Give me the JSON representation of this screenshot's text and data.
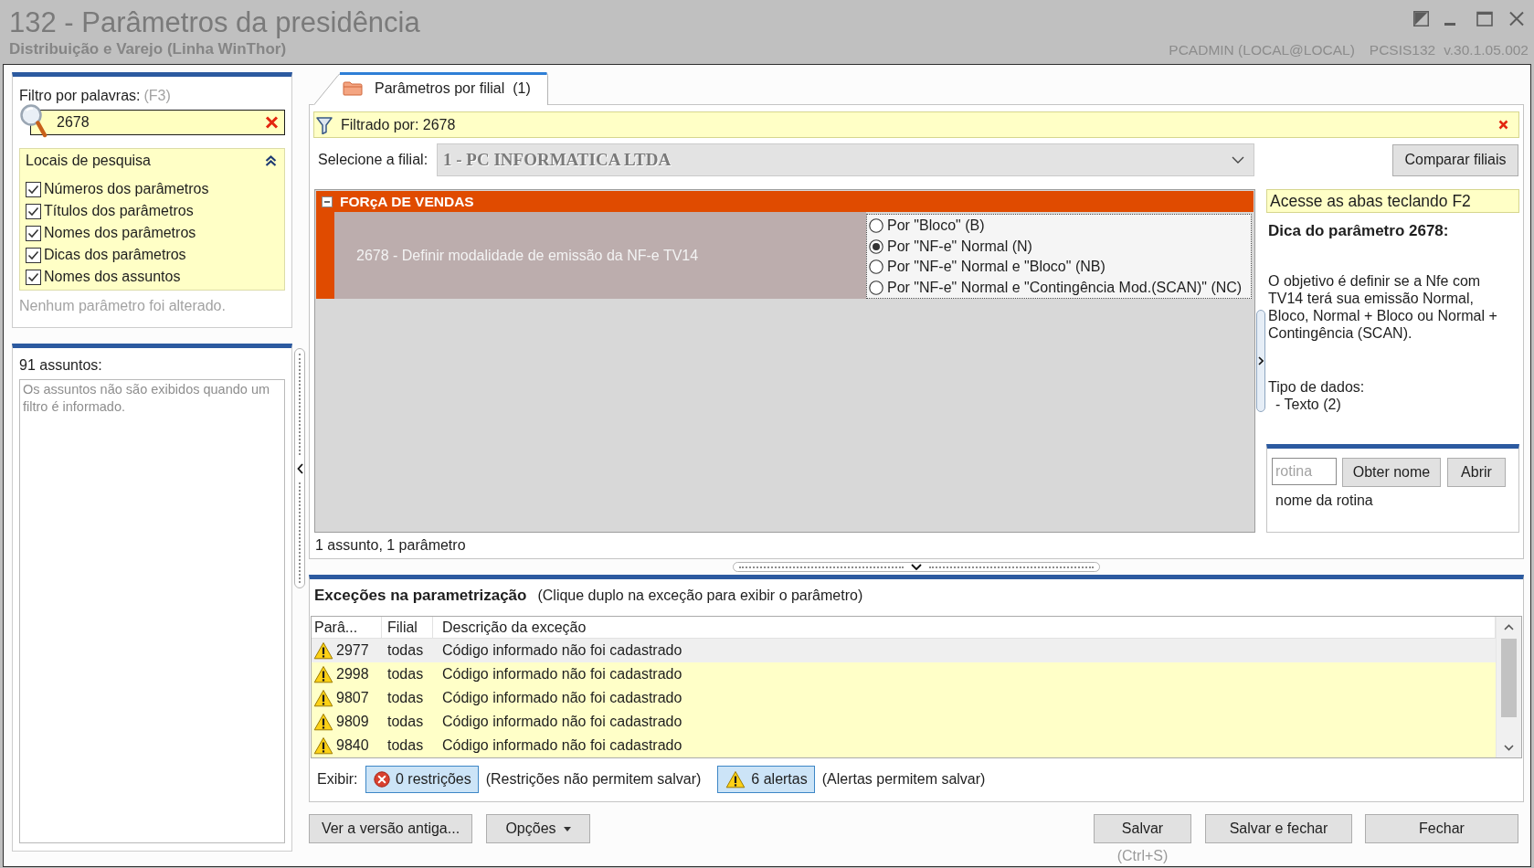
{
  "window": {
    "title": "132 - Parâmetros da presidência",
    "subtitle": "Distribuição e Varejo (Linha WinThor)",
    "user": "PCADMIN (LOCAL@LOCAL)",
    "program": "PCSIS132",
    "version": "v.30.1.05.002"
  },
  "filter_panel": {
    "label": "Filtro por palavras:",
    "shortcut": "(F3)",
    "search": {
      "value": "2678"
    },
    "search_places": {
      "title": "Locais de pesquisa",
      "expanded": true,
      "options": [
        {
          "label": "Números dos parâmetros",
          "checked": true
        },
        {
          "label": "Títulos dos parâmetros",
          "checked": true
        },
        {
          "label": "Nomes dos parâmetros",
          "checked": true
        },
        {
          "label": "Dicas dos parâmetros",
          "checked": true
        },
        {
          "label": "Nomes dos assuntos",
          "checked": true
        }
      ]
    },
    "status": "Nenhum parâmetro foi alterado."
  },
  "subjects_panel": {
    "label": "91 assuntos:",
    "message": "Os assuntos não são exibidos quando um filtro é informado."
  },
  "tabs": [
    {
      "label": "Parâmetros por filial",
      "count": "(1)",
      "selected": true
    }
  ],
  "filter_bar": {
    "text": "Filtrado por: 2678"
  },
  "branch_selector": {
    "label": "Selecione a filial:",
    "value": "1 - PC INFORMATICA LTDA",
    "disabled": true
  },
  "compare_button": {
    "label": "Comparar filiais"
  },
  "parameter_grid": {
    "groups": [
      {
        "title": "FORçA DE VENDAS",
        "expanded": true,
        "parameters": [
          {
            "label": "2678 - Definir modalidade de emissão da NF-e TV14",
            "options": [
              {
                "label": "Por \"Bloco\" (B)",
                "selected": false
              },
              {
                "label": "Por \"NF-e\" Normal (N)",
                "selected": true
              },
              {
                "label": "Por \"NF-e\" Normal e \"Bloco\" (NB)",
                "selected": false
              },
              {
                "label": "Por \"NF-e\" Normal e \"Contingência Mod.(SCAN)\" (NC)",
                "selected": false
              }
            ]
          }
        ]
      }
    ],
    "summary": "1 assunto, 1 parâmetro"
  },
  "hint_panel": {
    "notice": "Acesse as abas teclando F2",
    "title": "Dica do parâmetro 2678:",
    "description": "O objetivo é definir se a Nfe com TV14 terá sua emissão Normal, Bloco, Normal + Bloco ou Normal + Contingência (SCAN).",
    "data_type_label": "Tipo de dados:",
    "data_type": "- Texto (2)"
  },
  "routine_lookup": {
    "input": {
      "placeholder": "rotina"
    },
    "buttons": [
      "Obter nome",
      "Abrir"
    ],
    "result": "nome da rotina"
  },
  "exceptions": {
    "title": "Exceções na parametrização",
    "hint": "(Clique duplo na exceção para exibir o parâmetro)",
    "columns": [
      "Parâ...",
      "Filial",
      "Descrição da exceção"
    ],
    "rows": [
      {
        "parameter": "2977",
        "branch": "todas",
        "description": "Código informado não foi cadastrado",
        "selected": true
      },
      {
        "parameter": "2998",
        "branch": "todas",
        "description": "Código informado não foi cadastrado",
        "selected": false
      },
      {
        "parameter": "9807",
        "branch": "todas",
        "description": "Código informado não foi cadastrado",
        "selected": false
      },
      {
        "parameter": "9809",
        "branch": "todas",
        "description": "Código informado não foi cadastrado",
        "selected": false
      },
      {
        "parameter": "9840",
        "branch": "todas",
        "description": "Código informado não foi cadastrado",
        "selected": false
      }
    ],
    "show_label": "Exibir:",
    "toggles": [
      {
        "kind": "restriction",
        "label": "0 restrições",
        "note": "(Restrições não permitem salvar)",
        "on": true
      },
      {
        "kind": "alert",
        "label": "6 alertas",
        "note": "(Alertas permitem salvar)",
        "on": true
      }
    ]
  },
  "footer": {
    "left_buttons": [
      {
        "label": "Ver a versão antiga...",
        "menu": false
      },
      {
        "label": "Opções",
        "menu": true
      }
    ],
    "right_buttons": [
      {
        "label": "Salvar",
        "shortcut": "(Ctrl+S)"
      },
      {
        "label": "Salvar e fechar"
      },
      {
        "label": "Fechar"
      }
    ]
  }
}
